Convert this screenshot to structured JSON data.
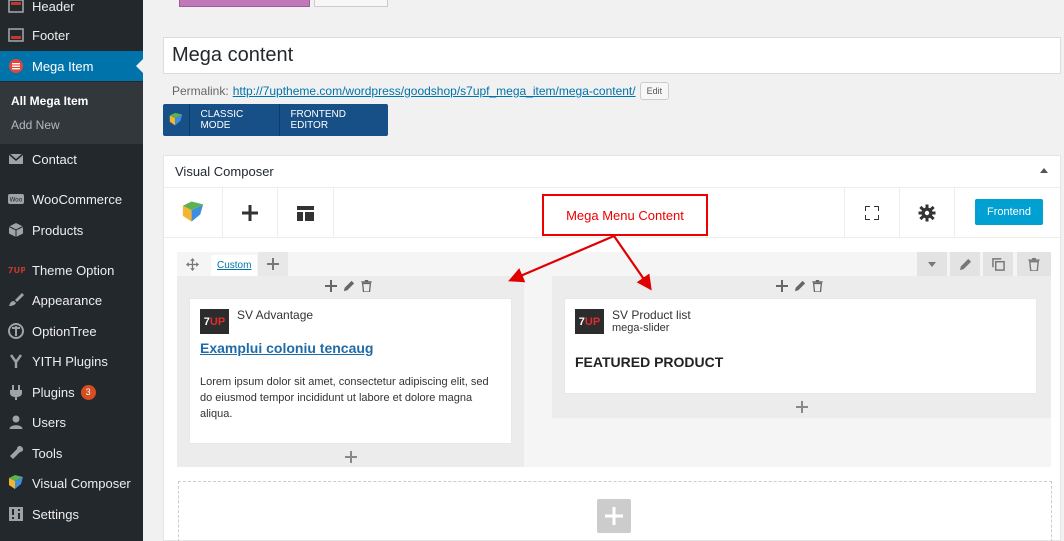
{
  "sidebar": {
    "items": [
      {
        "label": "Header",
        "icon": "header-icon"
      },
      {
        "label": "Footer",
        "icon": "footer-icon"
      },
      {
        "label": "Mega Item",
        "icon": "mega-item-icon"
      },
      {
        "label": "Contact",
        "icon": "mail-icon"
      },
      {
        "label": "WooCommerce",
        "icon": "woocommerce-icon"
      },
      {
        "label": "Products",
        "icon": "cube-icon"
      },
      {
        "label": "Theme Option",
        "icon": "7up-icon"
      },
      {
        "label": "Appearance",
        "icon": "brush-icon"
      },
      {
        "label": "OptionTree",
        "icon": "optiontree-icon"
      },
      {
        "label": "YITH Plugins",
        "icon": "yith-icon"
      },
      {
        "label": "Plugins",
        "icon": "plug-icon",
        "badge": "3"
      },
      {
        "label": "Users",
        "icon": "user-icon"
      },
      {
        "label": "Tools",
        "icon": "wrench-icon"
      },
      {
        "label": "Visual Composer",
        "icon": "vc-icon"
      },
      {
        "label": "Settings",
        "icon": "settings-icon"
      }
    ],
    "submenu": [
      {
        "label": "All Mega Item"
      },
      {
        "label": "Add New"
      }
    ]
  },
  "editor": {
    "title": "Mega content",
    "permalink_label": "Permalink:",
    "permalink_url": "http://7uptheme.com/wordpress/goodshop/s7upf_mega_item/mega-content/",
    "edit_label": "Edit",
    "classic_mode": "CLASSIC MODE",
    "frontend_editor": "FRONTEND EDITOR"
  },
  "vc": {
    "panel_title": "Visual Composer",
    "frontend_label": "Frontend",
    "row_tab": "Custom",
    "col1": {
      "element_title": "SV Advantage",
      "logo_7": "7",
      "logo_up": "UP",
      "link_text": "Examplui coloniu tencaug",
      "body": "Lorem ipsum dolor sit amet, consectetur adipiscing elit, sed do eiusmod tempor incididunt ut labore et dolore magna aliqua."
    },
    "col2": {
      "element_title": "SV Product list",
      "element_sub": "mega-slider",
      "logo_7": "7",
      "logo_up": "UP",
      "heading": "FEATURED PRODUCT"
    }
  },
  "annotation": {
    "text": "Mega Menu Content",
    "color": "#e00000"
  },
  "colors": {
    "sidebar_bg": "#23282d",
    "active_bg": "#0073aa",
    "mode_bar_bg": "#174f87",
    "frontend_btn": "#00a0d2"
  }
}
